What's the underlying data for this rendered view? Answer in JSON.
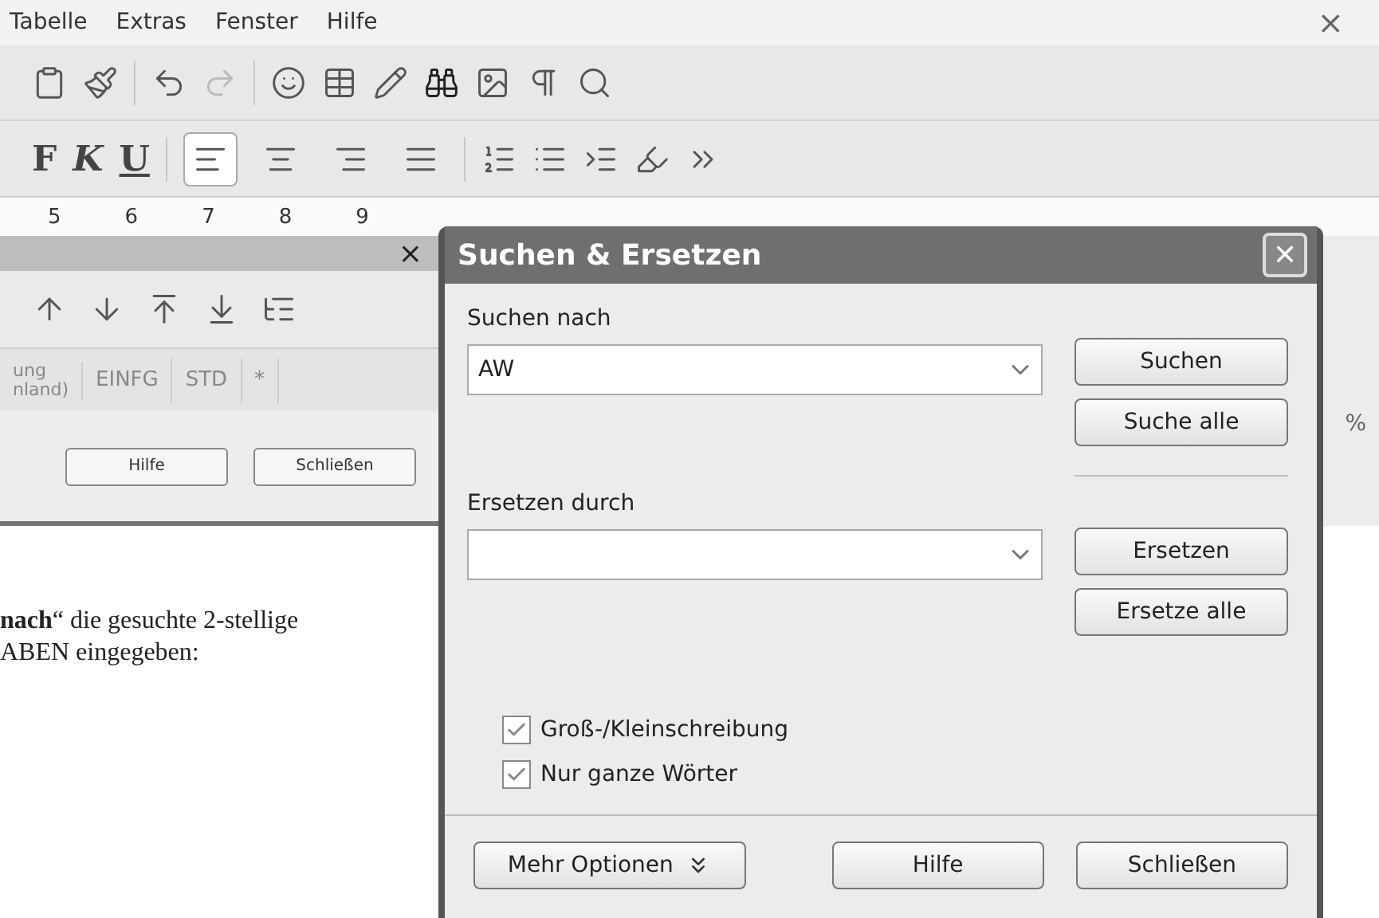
{
  "menu": [
    {
      "label": "Tabelle"
    },
    {
      "label": "Extras"
    },
    {
      "label": "Fenster"
    },
    {
      "label": "Hilfe"
    }
  ],
  "window_close": "×",
  "format_toolbar": [
    {
      "label": "F",
      "kind": "bold"
    },
    {
      "label": "K",
      "kind": "italic"
    },
    {
      "label": "U",
      "kind": "underline"
    }
  ],
  "alignment": [
    {
      "kind": "left",
      "selected": true
    },
    {
      "kind": "center",
      "selected": false
    },
    {
      "kind": "right",
      "selected": false
    },
    {
      "kind": "justify",
      "selected": false
    }
  ],
  "ruler": [
    "5",
    "6",
    "7",
    "8",
    "9"
  ],
  "navigator": {
    "close": "×",
    "buttons": [
      "Hilfe",
      "Schließen"
    ]
  },
  "status_bar": {
    "language_top": "ung",
    "language": "nland)",
    "mode": "EINFG",
    "selection": "STD",
    "modified": "*",
    "zoom": "%"
  },
  "document": {
    "lines": [
      "**nach**“ die gesuchte 2-stellige",
      "ABEN eingegeben:"
    ]
  },
  "dialog": {
    "title": "Suchen & Ersetzen",
    "close": "✕",
    "search": {
      "label": "Suchen nach",
      "value": "AW"
    },
    "search_buttons": [
      "Suchen",
      "Suche alle"
    ],
    "replace": {
      "label": "Ersetzen durch"
    },
    "replace_buttons": [
      "Ersetzen",
      "Ersetze alle"
    ],
    "options": [
      {
        "label": "Groß-/Kleinschreibung",
        "checked": true
      },
      {
        "label": "Nur ganze Wörter",
        "checked": true
      }
    ],
    "more_options": "Mehr Optionen",
    "footer_buttons": [
      "Hilfe",
      "Schließen"
    ]
  }
}
